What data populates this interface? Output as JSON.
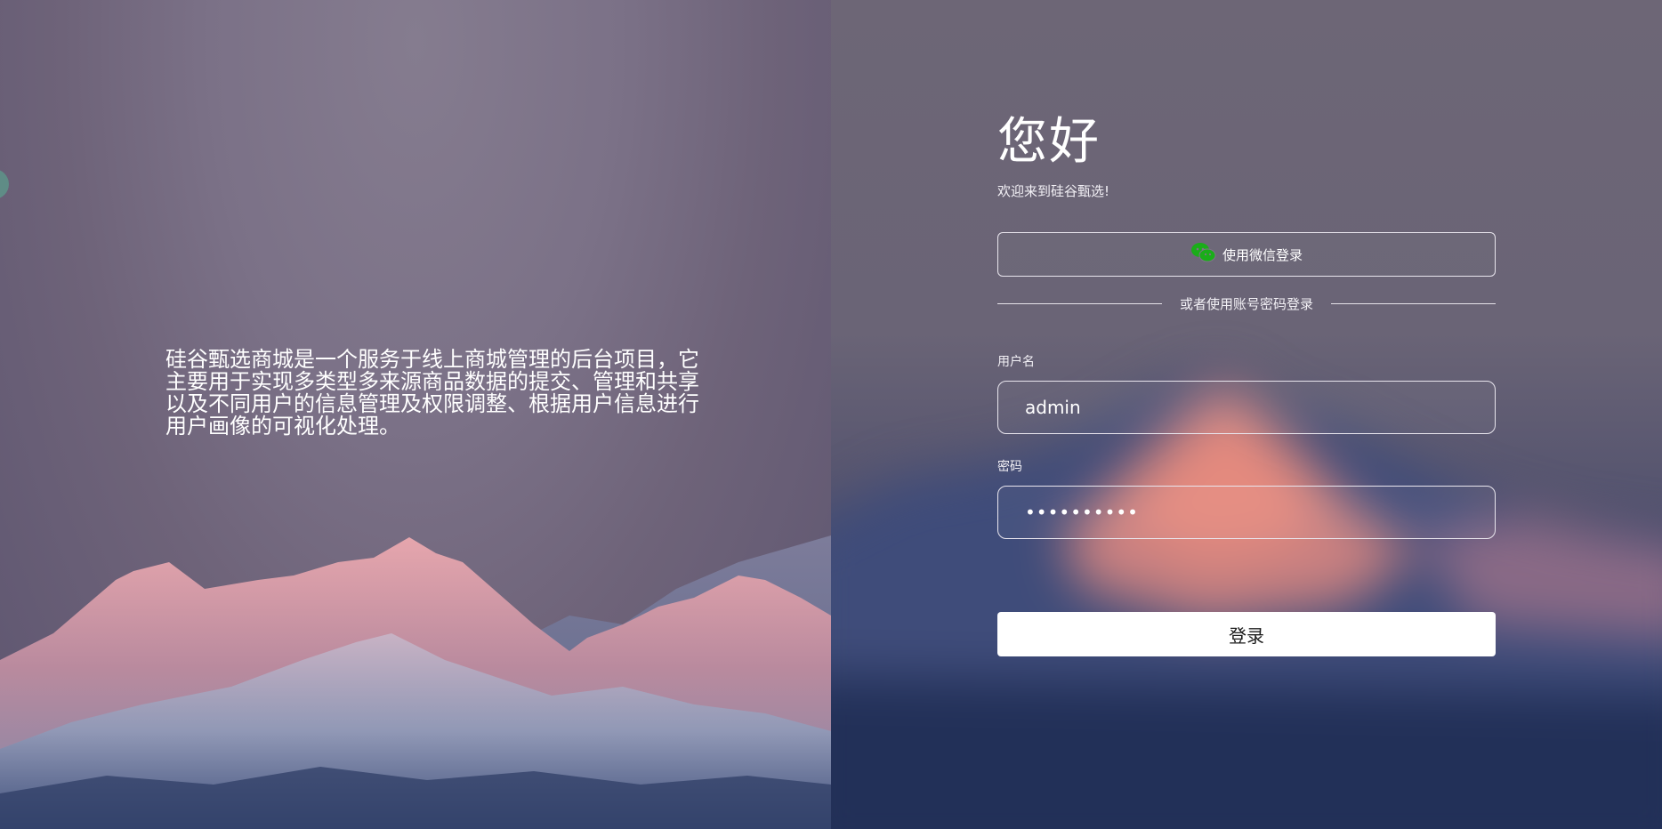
{
  "intro": {
    "text": "硅谷甄选商城是一个服务于线上商城管理的后台项目，它主要用于实现多类型多来源商品数据的提交、管理和共享以及不同用户的信息管理及权限调整、根据用户信息进行用户画像的可视化处理。"
  },
  "login": {
    "greeting": "您好",
    "welcome": "欢迎来到硅谷甄选!",
    "wechat_label": "使用微信登录",
    "divider_label": "或者使用账号密码登录",
    "username_label": "用户名",
    "username_value": "admin",
    "password_label": "密码",
    "password_value": "••••••••••",
    "submit_label": "登录"
  },
  "icons": {
    "wechat": "wechat-icon"
  },
  "colors": {
    "wechat_green": "#1aad19",
    "button_bg": "#ffffff",
    "button_text": "#1b1b1b"
  }
}
